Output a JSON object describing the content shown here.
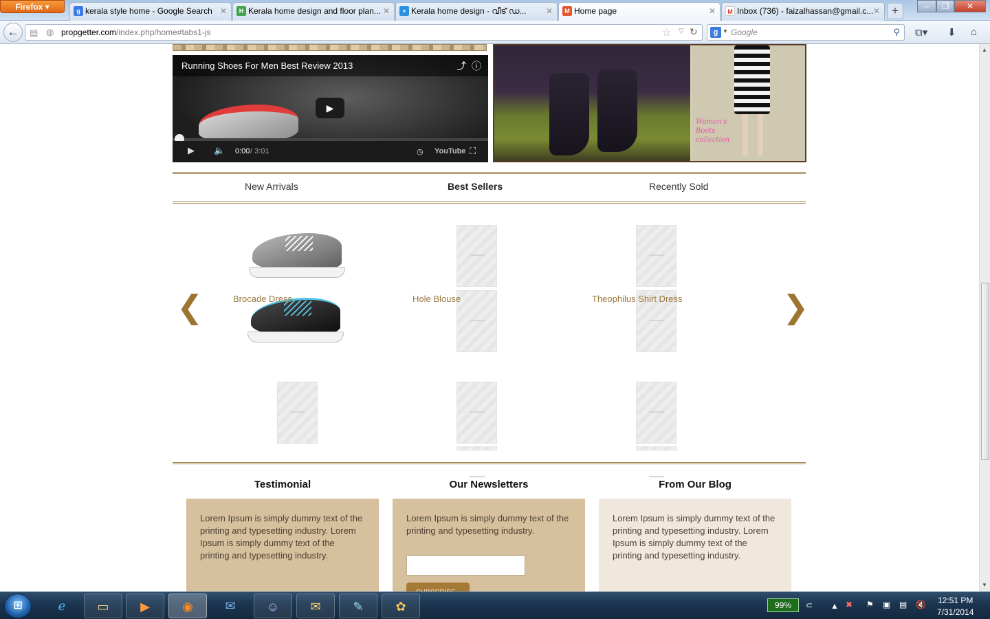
{
  "browser": {
    "app_button": "Firefox",
    "tabs": [
      {
        "label": "kerala style home - Google Search",
        "favicon": "google-icon",
        "color": "#3b78e7"
      },
      {
        "label": "Kerala home design and floor plan...",
        "favicon": "h-icon",
        "color": "#3fa34d"
      },
      {
        "label": "Kerala home design - വീട് ഡ...",
        "favicon": "plus-icon",
        "color": "#2a8fe0"
      },
      {
        "label": "Home page",
        "favicon": "magento-icon",
        "color": "#e3562b"
      },
      {
        "label": "Inbox (736) - faizalhassan@gmail.c...",
        "favicon": "gmail-icon",
        "color": "#d33a2c"
      }
    ],
    "url_host": "propgetter.com",
    "url_path": "/index.php/home#tabs1-js",
    "search_placeholder": "Google",
    "search_engine_glyph": "g"
  },
  "video": {
    "title": "Running Shoes For Men Best Review 2013",
    "time_current": "0:00",
    "time_total": " / 3:01",
    "brand": "YouTube"
  },
  "boots_banner": {
    "caption": "Women's Boots collection"
  },
  "product_tabs": [
    "New Arrivals",
    "Best Sellers",
    "Recently Sold"
  ],
  "active_product_tab": 1,
  "products": [
    {
      "name": "Brocade Dress"
    },
    {
      "name": "Hole Blouse"
    },
    {
      "name": "Theophilus Shirt Dress"
    }
  ],
  "carousel": {
    "prev": "❮",
    "next": "❯"
  },
  "footer_columns": {
    "testimonial": {
      "title": "Testimonial",
      "text": "Lorem Ipsum is simply dummy text of the printing and typesetting industry. Lorem Ipsum is simply dummy text of the printing and typesetting industry."
    },
    "newsletter": {
      "title": "Our Newsletters",
      "text": "Lorem Ipsum is simply dummy text of the printing and typesetting industry.",
      "input_placeholder": "",
      "button": "Subscribe"
    },
    "blog": {
      "title": "From Our Blog",
      "text": "Lorem Ipsum is simply dummy text of the printing and typesetting industry. Lorem Ipsum is simply dummy text of the printing and typesetting industry."
    }
  },
  "taskbar": {
    "start_icon": "windows-orb-icon",
    "apps": [
      "ie-icon",
      "explorer-icon",
      "media-player-icon",
      "firefox-icon",
      "thunderbird-icon",
      "pidgin-icon",
      "outlook-icon",
      "notepad-icon",
      "paint-icon"
    ],
    "battery": "99%",
    "clock_time": "12:51 PM",
    "clock_date": "7/31/2014"
  },
  "colors": {
    "accent_gold": "#a0824e",
    "product_link": "#9b7a3e",
    "tan_box": "#d6c09e",
    "light_box": "#f0e8dc"
  }
}
